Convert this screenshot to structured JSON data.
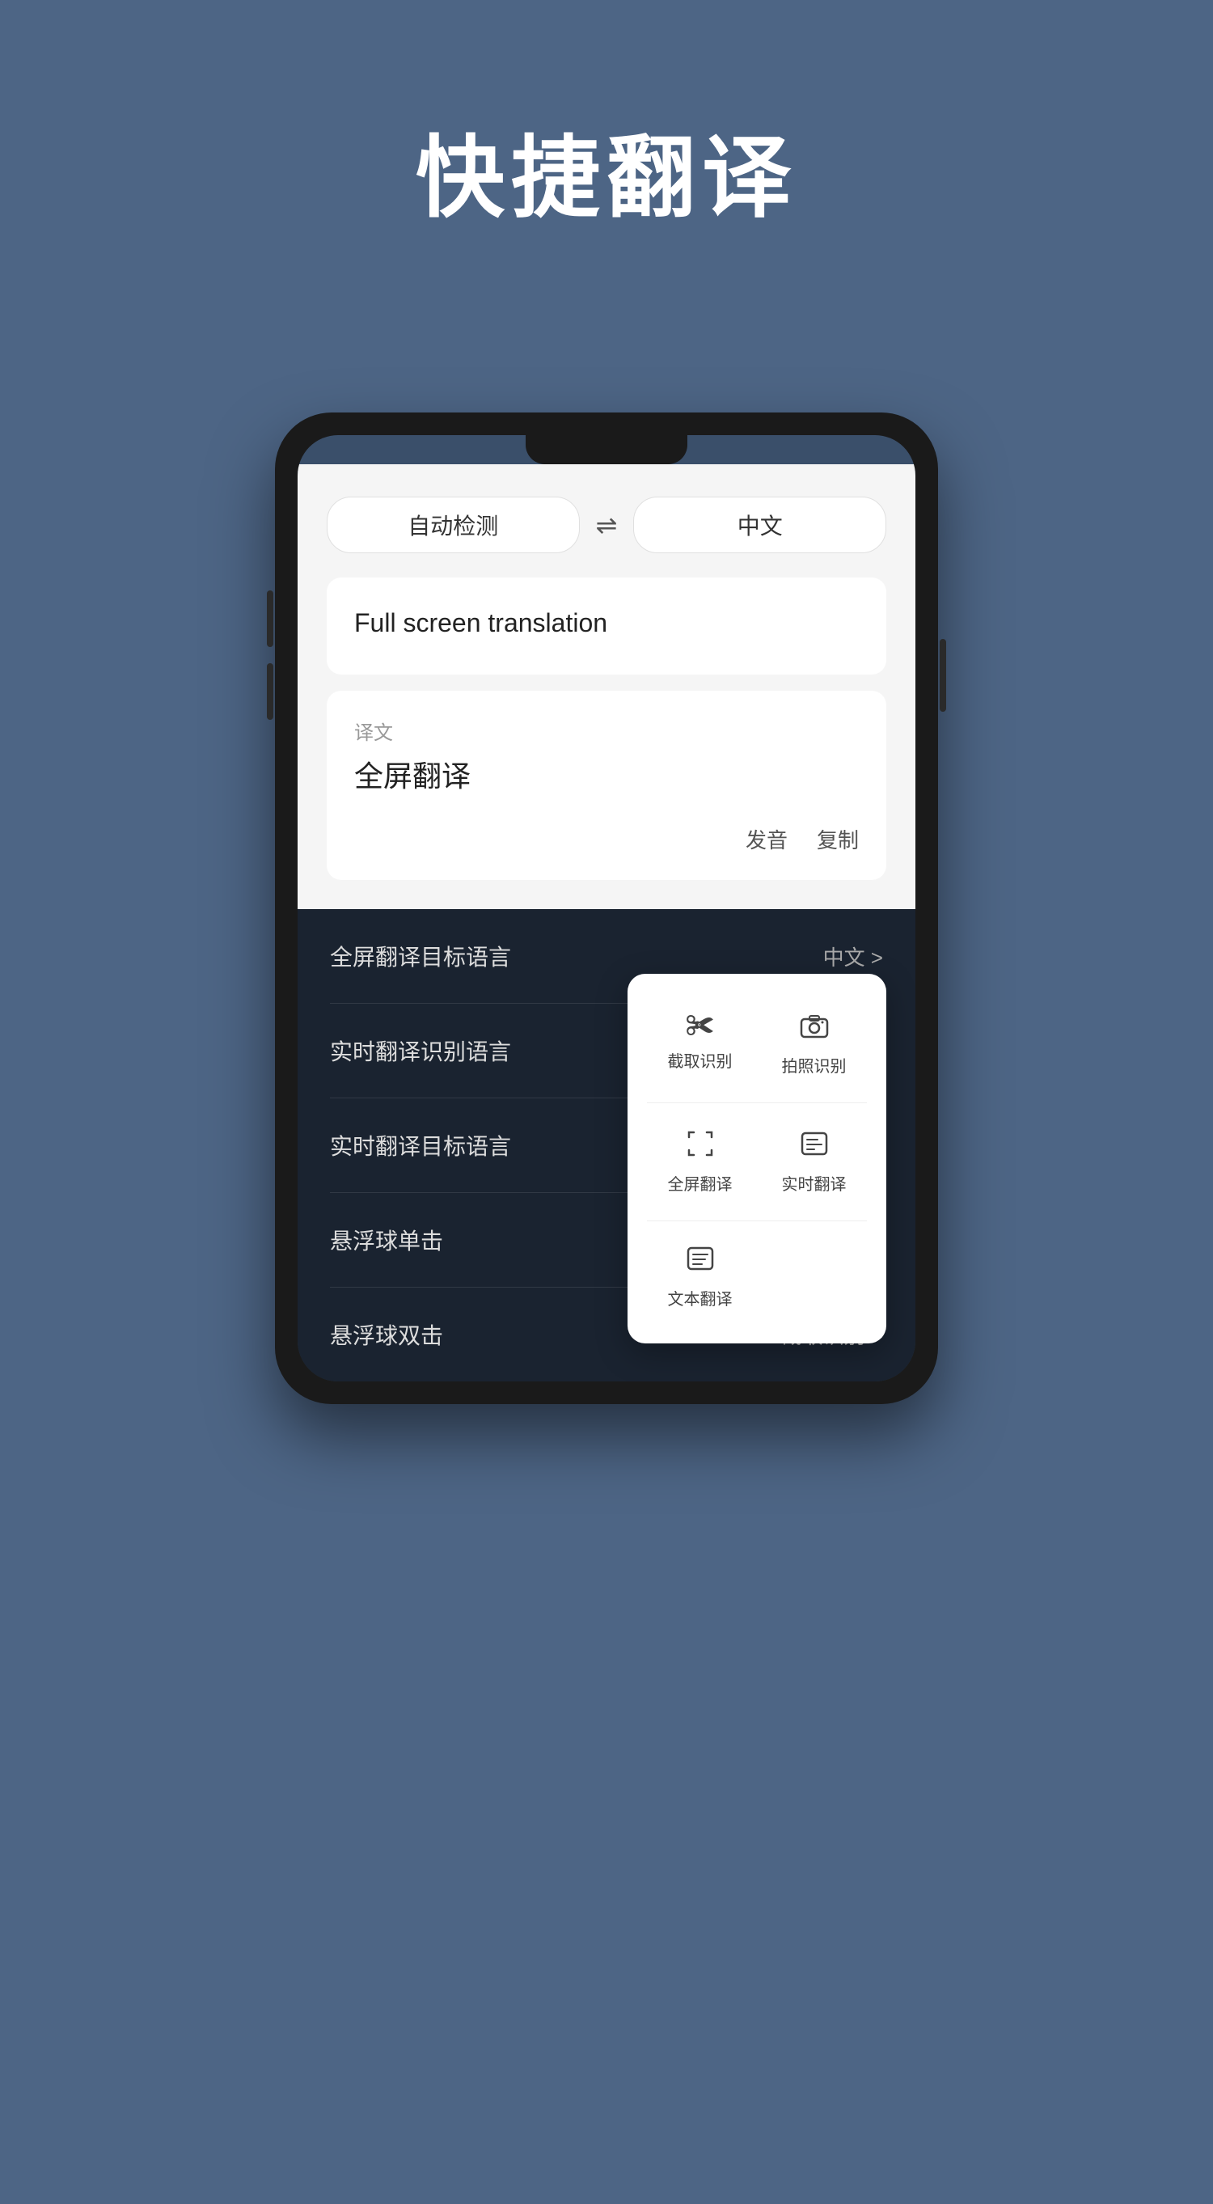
{
  "page": {
    "title": "快捷翻译",
    "background": "#4d6585"
  },
  "translator": {
    "source_lang": "自动检测",
    "swap_symbol": "⇌",
    "target_lang": "中文",
    "input_text": "Full screen translation",
    "result_label": "译文",
    "result_text": "全屏翻译",
    "action_pronounce": "发音",
    "action_copy": "复制"
  },
  "settings": {
    "items": [
      {
        "label": "全屏翻译目标语言",
        "value": "中文 >"
      },
      {
        "label": "实时翻译识别语言",
        "value": ""
      },
      {
        "label": "实时翻译目标语言",
        "value": ""
      },
      {
        "label": "悬浮球单击",
        "value": ""
      },
      {
        "label": "悬浮球双击",
        "value": "截取识别 >"
      }
    ]
  },
  "quick_actions": {
    "items": [
      {
        "icon": "✂",
        "label": "截取识别"
      },
      {
        "icon": "📷",
        "label": "拍照识别"
      },
      {
        "icon": "⬜",
        "label": "全屏翻译"
      },
      {
        "icon": "📋",
        "label": "实时翻译"
      },
      {
        "icon": "📄",
        "label": "文本翻译"
      }
    ]
  }
}
